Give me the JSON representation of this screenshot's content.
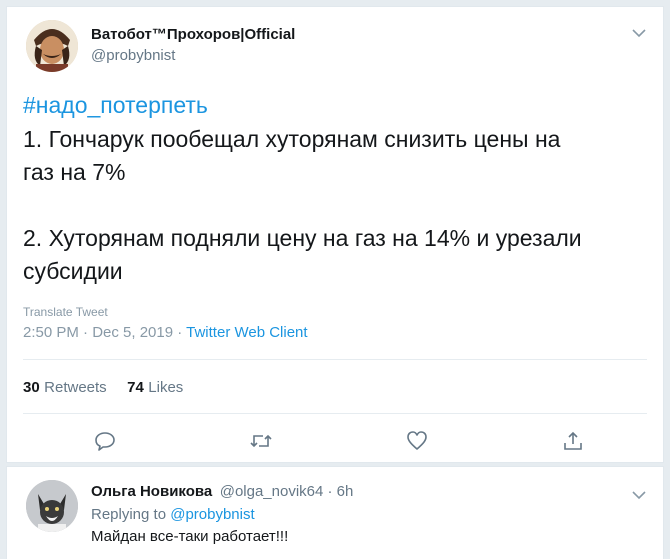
{
  "tweet": {
    "author_name": "Ватобот™Прохоров|Official",
    "author_handle": "@probybnist",
    "hashtag": "#надо_потерпеть",
    "line1": "1. Гончарук пообещал хуторянам снизить цены на",
    "line2": "газ на 7%",
    "line3": "2. Хуторянам подняли цену на газ на 14% и урезали",
    "line4": "субсидии",
    "translate": "Translate Tweet",
    "timestamp": "2:50 PM · Dec 5, 2019 · ",
    "client": "Twitter Web Client",
    "retweets_count": "30",
    "retweets_label": "Retweets",
    "likes_count": "74",
    "likes_label": "Likes"
  },
  "reply": {
    "author_name": "Ольга Новикова",
    "author_handle": "@olga_novik64 · 6h",
    "replying_prefix": "Replying to ",
    "replying_to": "@probybnist",
    "text": "Майдан все-таки работает!!!"
  },
  "colors": {
    "accent": "#1b95e0",
    "muted": "#657786",
    "icon": "#657786"
  },
  "icons": {
    "menu": "chevron-down-icon",
    "reply": "reply-icon",
    "retweet": "retweet-icon",
    "like": "heart-icon",
    "share": "share-icon"
  }
}
